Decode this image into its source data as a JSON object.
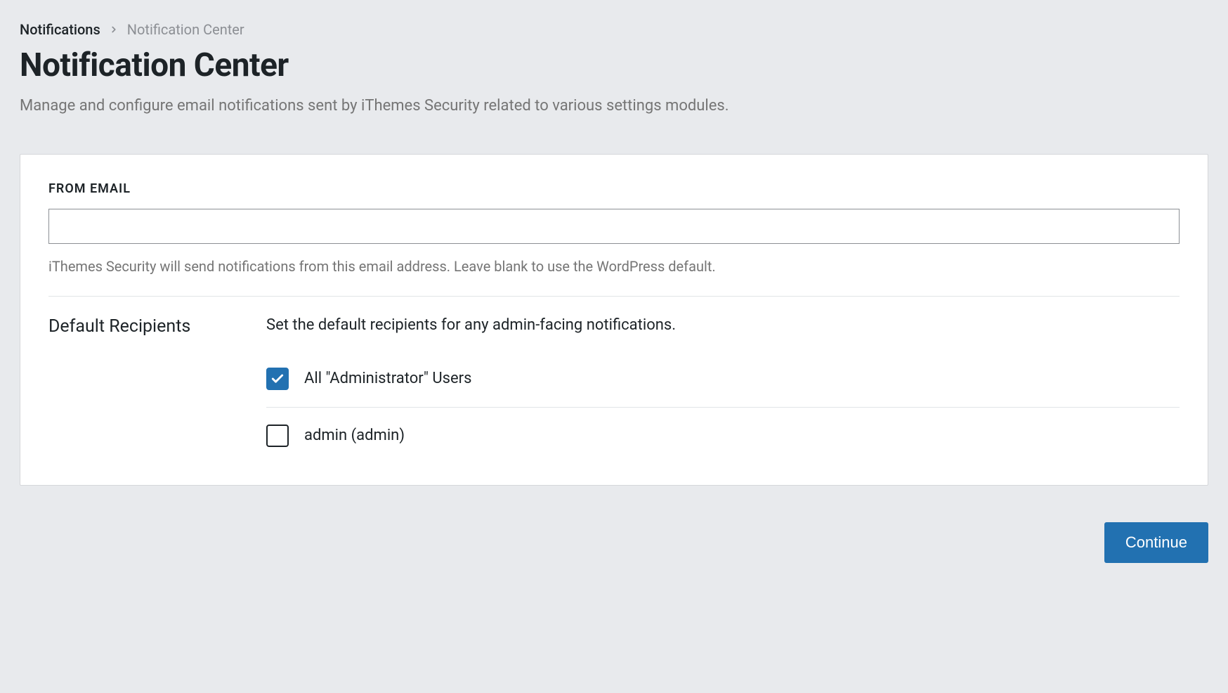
{
  "breadcrumb": {
    "root": "Notifications",
    "current": "Notification Center"
  },
  "header": {
    "title": "Notification Center",
    "description": "Manage and configure email notifications sent by iThemes Security related to various settings modules."
  },
  "from_email": {
    "label": "FROM EMAIL",
    "value": "",
    "help": "iThemes Security will send notifications from this email address. Leave blank to use the WordPress default."
  },
  "recipients": {
    "label": "Default Recipients",
    "description": "Set the default recipients for any admin-facing notifications.",
    "items": [
      {
        "label": "All \"Administrator\" Users",
        "checked": true
      },
      {
        "label": "admin (admin)",
        "checked": false
      }
    ]
  },
  "footer": {
    "continue_label": "Continue"
  }
}
